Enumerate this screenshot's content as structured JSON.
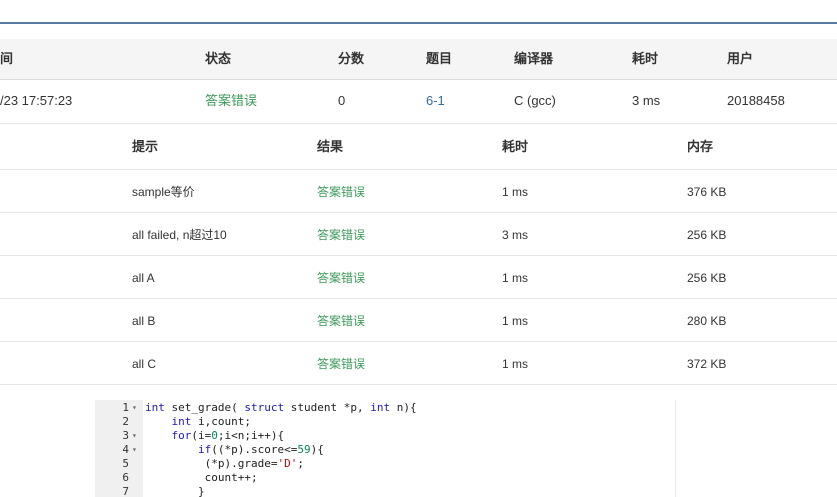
{
  "summary": {
    "headers": [
      "间",
      "状态",
      "分数",
      "题目",
      "编译器",
      "耗时",
      "用户"
    ],
    "row": {
      "time": "/23 17:57:23",
      "status": "答案错误",
      "score": "0",
      "problem": "6-1",
      "compiler": "C (gcc)",
      "elapsed": "3 ms",
      "user": "20188458"
    }
  },
  "details": {
    "headers": [
      "提示",
      "结果",
      "耗时",
      "内存"
    ],
    "rows": [
      {
        "hint": "sample等价",
        "result": "答案错误",
        "time": "1 ms",
        "memory": "376 KB"
      },
      {
        "hint": "all failed, n超过10",
        "result": "答案错误",
        "time": "3 ms",
        "memory": "256 KB"
      },
      {
        "hint": "all A",
        "result": "答案错误",
        "time": "1 ms",
        "memory": "256 KB"
      },
      {
        "hint": "all B",
        "result": "答案错误",
        "time": "1 ms",
        "memory": "280 KB"
      },
      {
        "hint": "all C",
        "result": "答案错误",
        "time": "1 ms",
        "memory": "372 KB"
      }
    ]
  },
  "code": {
    "lines": [
      {
        "n": "1",
        "fold": "▾",
        "tokens": [
          [
            "kw",
            "int"
          ],
          [
            "t",
            " set_grade( "
          ],
          [
            "kw",
            "struct"
          ],
          [
            "t",
            " student *p, "
          ],
          [
            "kw",
            "int"
          ],
          [
            "t",
            " n){"
          ]
        ]
      },
      {
        "n": "2",
        "fold": "",
        "tokens": [
          [
            "t",
            "    "
          ],
          [
            "kw",
            "int"
          ],
          [
            "t",
            " i,count;"
          ]
        ]
      },
      {
        "n": "3",
        "fold": "▾",
        "tokens": [
          [
            "t",
            "    "
          ],
          [
            "kw",
            "for"
          ],
          [
            "t",
            "(i="
          ],
          [
            "num",
            "0"
          ],
          [
            "t",
            ";i<n;i++){"
          ]
        ]
      },
      {
        "n": "4",
        "fold": "▾",
        "tokens": [
          [
            "t",
            "        "
          ],
          [
            "kw",
            "if"
          ],
          [
            "t",
            "((*p).score<="
          ],
          [
            "num",
            "59"
          ],
          [
            "t",
            "){"
          ]
        ]
      },
      {
        "n": "5",
        "fold": "",
        "tokens": [
          [
            "t",
            "         (*p).grade="
          ],
          [
            "str",
            "'D'"
          ],
          [
            "t",
            ";"
          ]
        ]
      },
      {
        "n": "6",
        "fold": "",
        "tokens": [
          [
            "t",
            "         count++;"
          ]
        ]
      },
      {
        "n": "7",
        "fold": "",
        "tokens": [
          [
            "t",
            "        }"
          ]
        ]
      }
    ]
  }
}
